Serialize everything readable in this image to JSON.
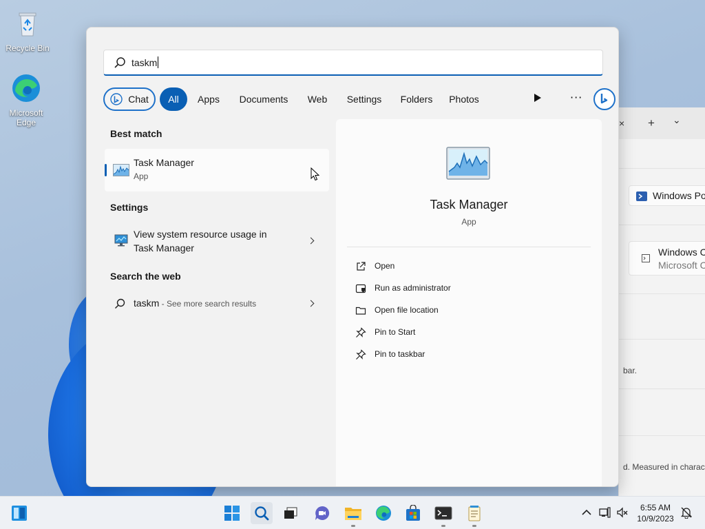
{
  "desktop": {
    "icons": [
      {
        "label": "Recycle Bin",
        "icon": "recycle-bin-icon"
      },
      {
        "label": "Microsoft Edge",
        "icon": "edge-icon"
      }
    ]
  },
  "background_window": {
    "tab_close": "×",
    "tab_new": "+",
    "tab_dropdown": "⌄",
    "card1": "Windows Po",
    "card2_title": "Windows C",
    "card2_sub": "Microsoft C",
    "text1": "bar.",
    "text2": "d. Measured in characte"
  },
  "search": {
    "query": "taskm",
    "filters": [
      "Chat",
      "All",
      "Apps",
      "Documents",
      "Web",
      "Settings",
      "Folders",
      "Photos"
    ],
    "active_filter": "All",
    "accent": "#0a5fb4"
  },
  "results": {
    "best_match_heading": "Best match",
    "best_match": {
      "name": "Task Manager",
      "type": "App",
      "icon": "task-manager-icon"
    },
    "settings_heading": "Settings",
    "settings_item": {
      "line1": "View system resource usage in",
      "line2": "Task Manager",
      "icon": "monitor-settings-icon"
    },
    "web_heading": "Search the web",
    "web_item": {
      "query": "taskm",
      "suffix": " - See more search results",
      "icon": "search-icon"
    }
  },
  "detail": {
    "title": "Task Manager",
    "kind": "App",
    "actions": [
      {
        "label": "Open",
        "icon": "open-external-icon"
      },
      {
        "label": "Run as administrator",
        "icon": "shield-icon"
      },
      {
        "label": "Open file location",
        "icon": "folder-icon"
      },
      {
        "label": "Pin to Start",
        "icon": "pin-icon"
      },
      {
        "label": "Pin to taskbar",
        "icon": "pin-icon"
      }
    ]
  },
  "taskbar": {
    "apps": [
      "widgets",
      "start",
      "search",
      "task-view",
      "chat",
      "file-explorer",
      "edge",
      "store",
      "terminal",
      "notepad"
    ],
    "time": "6:55 AM",
    "date": "10/9/2023"
  }
}
